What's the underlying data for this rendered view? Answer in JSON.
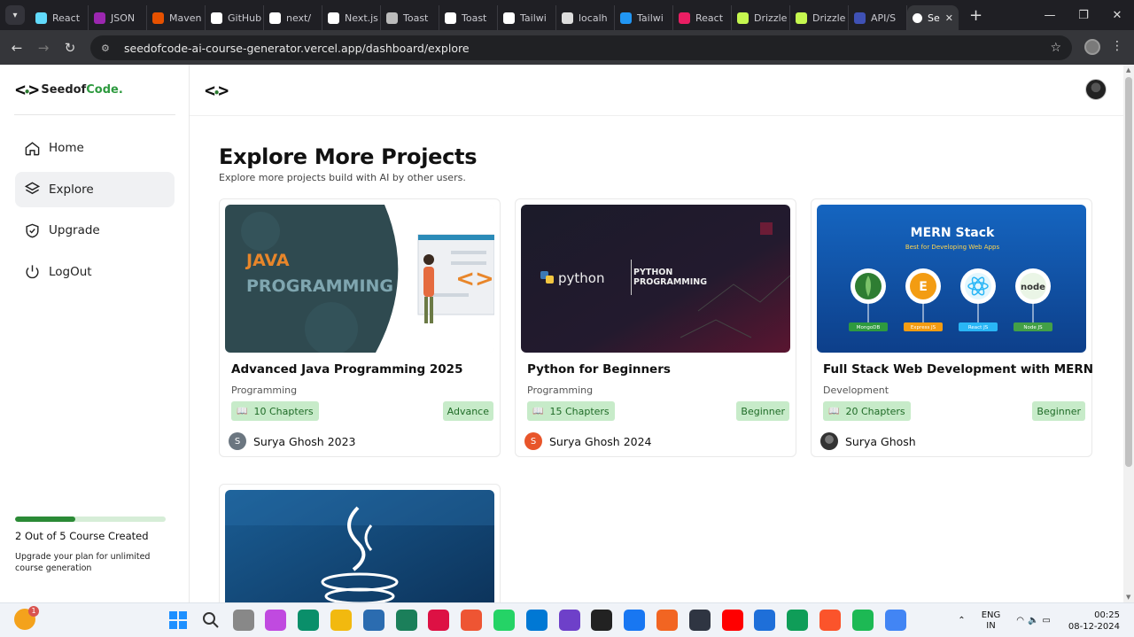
{
  "browser": {
    "tabs": [
      {
        "label": "React",
        "color": "#61dafb"
      },
      {
        "label": "JSON",
        "color": "#9c27b0"
      },
      {
        "label": "Maven",
        "color": "#e65100"
      },
      {
        "label": "GitHub",
        "color": "#ffffff"
      },
      {
        "label": "next/",
        "color": "#ffffff"
      },
      {
        "label": "Next.js",
        "color": "#ffffff"
      },
      {
        "label": "Toast",
        "color": "#bbbbbb"
      },
      {
        "label": "Toast",
        "color": "#ffffff"
      },
      {
        "label": "Tailwi",
        "color": "#ffffff"
      },
      {
        "label": "localh",
        "color": "#dddddd"
      },
      {
        "label": "Tailwi",
        "color": "#2196f3"
      },
      {
        "label": "React",
        "color": "#e91e63"
      },
      {
        "label": "Drizzle",
        "color": "#c5f74f"
      },
      {
        "label": "Drizzle",
        "color": "#c5f74f"
      },
      {
        "label": "API/S",
        "color": "#3f51b5"
      }
    ],
    "active_tab": {
      "label": "Se"
    },
    "url": "seedofcode-ai-course-generator.vercel.app/dashboard/explore"
  },
  "sidebar": {
    "brand_prefix": "Seedof",
    "brand_suffix": "Code.",
    "nav": [
      {
        "label": "Home",
        "icon": "home-icon"
      },
      {
        "label": "Explore",
        "icon": "layers-icon",
        "active": true
      },
      {
        "label": "Upgrade",
        "icon": "shield-check-icon"
      },
      {
        "label": "LogOut",
        "icon": "power-icon"
      }
    ],
    "usage": {
      "progress_fraction": 0.4,
      "count_text": "2 Out of 5 Course Created",
      "note": "Upgrade your plan for unlimited course generation"
    }
  },
  "main": {
    "title": "Explore More Projects",
    "subtitle": "Explore more projects build with AI by other users."
  },
  "courses": [
    {
      "title": "Advanced Java Programming 2025",
      "category": "Programming",
      "chapters": "10 Chapters",
      "level": "Advance",
      "author": "Surya Ghosh 2023",
      "author_initial": "S",
      "avatar_color": "#6b7680",
      "banner": {
        "line1": "JAVA",
        "line2": "PROGRAMMING"
      }
    },
    {
      "title": "Python for Beginners",
      "category": "Programming",
      "chapters": "15 Chapters",
      "level": "Beginner",
      "author": "Surya Ghosh 2024",
      "author_initial": "S",
      "avatar_color": "#e8552a",
      "banner": {
        "line1": "python",
        "line2": "PYTHON",
        "line3": "PROGRAMMING"
      }
    },
    {
      "title": "Full Stack Web Development with MERN",
      "category": "Development",
      "chapters": "20 Chapters",
      "level": "Beginner",
      "author": "Surya Ghosh",
      "author_initial": "",
      "avatar_color": "#333333",
      "banner": {
        "title": "MERN Stack",
        "subtitle": "Best for Developing Web Apps",
        "labels": [
          "MongoDB",
          "Express JS",
          "React JS",
          "Node JS"
        ]
      }
    }
  ],
  "taskbar": {
    "lang_line1": "ENG",
    "lang_line2": "IN",
    "time": "00:25",
    "date": "08-12-2024",
    "weather_badge": "1"
  }
}
